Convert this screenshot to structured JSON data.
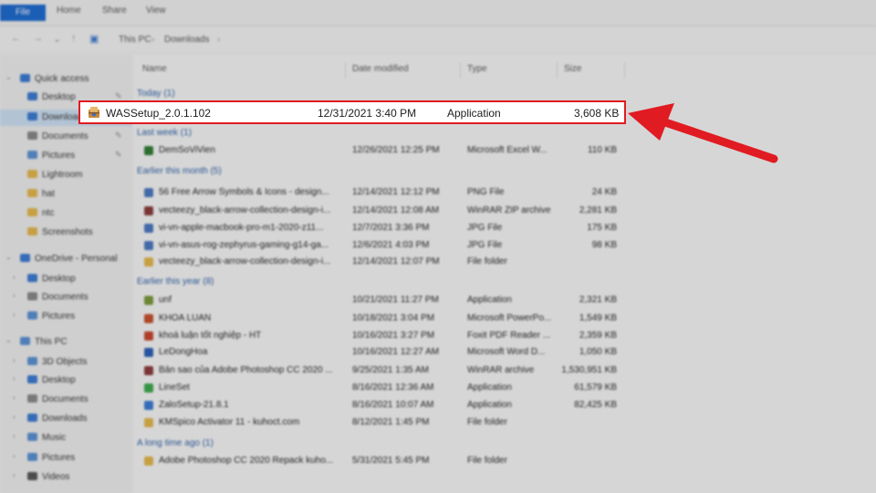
{
  "ribbon": {
    "tabs": [
      "File",
      "Home",
      "Share",
      "View"
    ]
  },
  "address": {
    "crumbs": [
      "This PC",
      "Downloads"
    ]
  },
  "sidebar": {
    "items": [
      {
        "label": "Quick access",
        "color": "#3b7bd4",
        "pin": ""
      },
      {
        "label": "Desktop",
        "color": "#3b7bd4",
        "pin": "✎"
      },
      {
        "label": "Downloads",
        "color": "#3b7bd4",
        "pin": "✎",
        "selected": true
      },
      {
        "label": "Documents",
        "color": "#8a8a8a",
        "pin": "✎"
      },
      {
        "label": "Pictures",
        "color": "#5a92d6",
        "pin": "✎"
      },
      {
        "label": "Lightroom",
        "color": "#e6b84a",
        "pin": ""
      },
      {
        "label": "hat",
        "color": "#e6b84a",
        "pin": ""
      },
      {
        "label": "ntc",
        "color": "#e6b84a",
        "pin": ""
      },
      {
        "label": "Screenshots",
        "color": "#e6b84a",
        "pin": ""
      },
      {
        "label": "OneDrive - Personal",
        "color": "#3b7bd4",
        "pin": ""
      },
      {
        "label": "Desktop",
        "color": "#3b7bd4",
        "pin": ""
      },
      {
        "label": "Documents",
        "color": "#8a8a8a",
        "pin": ""
      },
      {
        "label": "Pictures",
        "color": "#5a92d6",
        "pin": ""
      },
      {
        "label": "This PC",
        "color": "#5a92d6",
        "pin": ""
      },
      {
        "label": "3D Objects",
        "color": "#5a92d6",
        "pin": ""
      },
      {
        "label": "Desktop",
        "color": "#3b7bd4",
        "pin": ""
      },
      {
        "label": "Documents",
        "color": "#8a8a8a",
        "pin": ""
      },
      {
        "label": "Downloads",
        "color": "#3b7bd4",
        "pin": ""
      },
      {
        "label": "Music",
        "color": "#5a92d6",
        "pin": ""
      },
      {
        "label": "Pictures",
        "color": "#5a92d6",
        "pin": ""
      },
      {
        "label": "Videos",
        "color": "#555555",
        "pin": ""
      }
    ]
  },
  "columns": {
    "name": "Name",
    "date": "Date modified",
    "type": "Type",
    "size": "Size"
  },
  "groups": {
    "today": "Today (1)",
    "last_week": "Last week (1)",
    "earlier_month": "Earlier this month (5)",
    "earlier_year": "Earlier this year (8)",
    "long_ago": "A long time ago (1)"
  },
  "highlighted_file": {
    "name": "WASSetup_2.0.1.102",
    "date": "12/31/2021 3:40 PM",
    "type": "Application",
    "size": "3,608 KB"
  },
  "files": [
    {
      "name": "DemSoViVien",
      "date": "12/26/2021 12:25 PM",
      "type": "Microsoft Excel W...",
      "size": "110 KB",
      "color": "#2e7d32"
    },
    {
      "name": "56 Free Arrow Symbols & Icons - design...",
      "date": "12/14/2021 12:12 PM",
      "type": "PNG File",
      "size": "24 KB",
      "color": "#4a78c2"
    },
    {
      "name": "vecteezy_black-arrow-collection-design-i...",
      "date": "12/14/2021 12:08 AM",
      "type": "WinRAR ZIP archive",
      "size": "2,281 KB",
      "color": "#8b3a3a"
    },
    {
      "name": "vi-vn-apple-macbook-pro-m1-2020-z11...",
      "date": "12/7/2021 3:36 PM",
      "type": "JPG File",
      "size": "175 KB",
      "color": "#4a78c2"
    },
    {
      "name": "vi-vn-asus-rog-zephyrus-gaming-g14-ga...",
      "date": "12/6/2021 4:03 PM",
      "type": "JPG File",
      "size": "98 KB",
      "color": "#4a78c2"
    },
    {
      "name": "vecteezy_black-arrow-collection-design-i...",
      "date": "12/14/2021 12:07 PM",
      "type": "File folder",
      "size": "",
      "color": "#e6b84a"
    },
    {
      "name": "unf",
      "date": "10/21/2021 11:27 PM",
      "type": "Application",
      "size": "2,321 KB",
      "color": "#7a9a3a"
    },
    {
      "name": "KHOA LUAN",
      "date": "10/18/2021 3:04 PM",
      "type": "Microsoft PowerPo...",
      "size": "1,549 KB",
      "color": "#c94f2b"
    },
    {
      "name": "khoá luận tốt nghiệp - HT",
      "date": "10/16/2021 3:27 PM",
      "type": "Foxit PDF Reader ...",
      "size": "2,359 KB",
      "color": "#c9442b"
    },
    {
      "name": "LeDongHoa",
      "date": "10/16/2021 12:27 AM",
      "type": "Microsoft Word D...",
      "size": "1,050 KB",
      "color": "#2b5fb5"
    },
    {
      "name": "Bản sao của Adobe Photoshop CC 2020 ...",
      "date": "9/25/2021 1:35 AM",
      "type": "WinRAR archive",
      "size": "1,530,951 KB",
      "color": "#8b3a3a"
    },
    {
      "name": "LineSet",
      "date": "8/16/2021 12:36 AM",
      "type": "Application",
      "size": "61,579 KB",
      "color": "#3aaa4a"
    },
    {
      "name": "ZaloSetup-21.8.1",
      "date": "8/16/2021 10:07 AM",
      "type": "Application",
      "size": "82,425 KB",
      "color": "#3b7bd4"
    },
    {
      "name": "KMSpico Activator 11 - kuhoct.com",
      "date": "8/12/2021 1:45 PM",
      "type": "File folder",
      "size": "",
      "color": "#e6b84a"
    },
    {
      "name": "Adobe Photoshop CC 2020 Repack kuho...",
      "date": "5/31/2021 5:45 PM",
      "type": "File folder",
      "size": "",
      "color": "#e6b84a"
    }
  ]
}
